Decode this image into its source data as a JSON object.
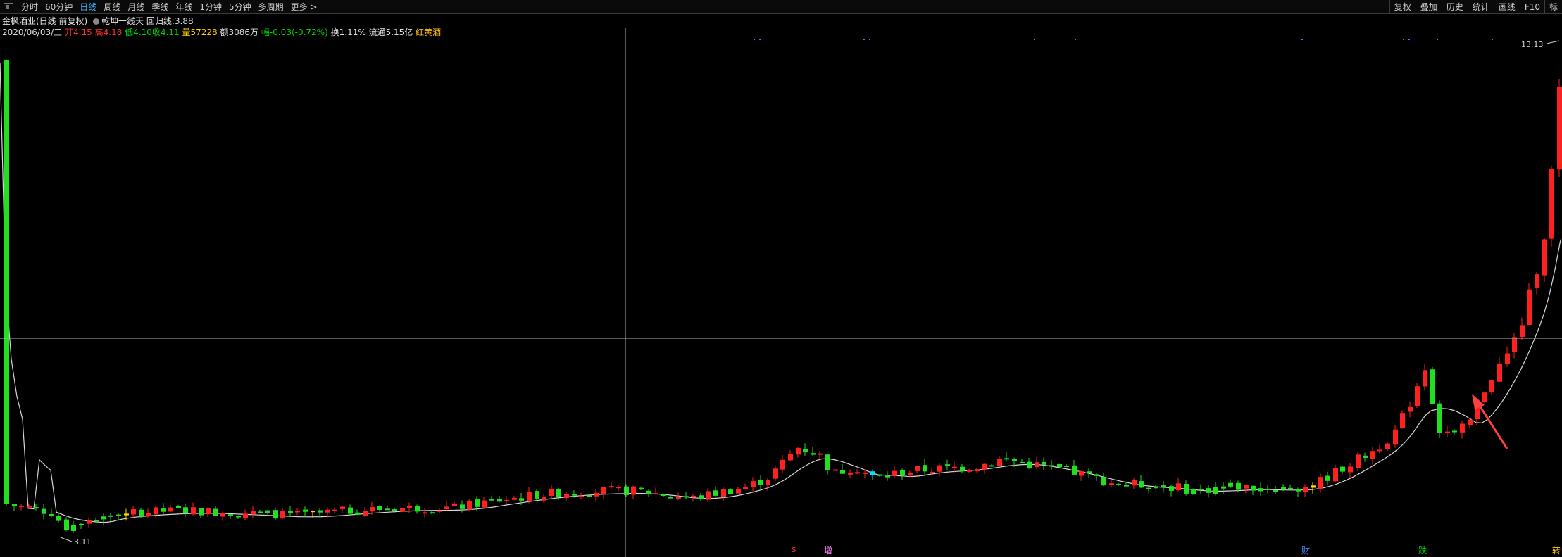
{
  "toolbar": {
    "items": [
      "分时",
      "60分钟",
      "日线",
      "周线",
      "月线",
      "季线",
      "年线",
      "1分钟",
      "5分钟",
      "多周期",
      "更多 >"
    ],
    "active": "日线",
    "right_buttons": [
      "复权",
      "叠加",
      "历史",
      "统计",
      "画线",
      "F10",
      "标"
    ]
  },
  "header": {
    "title": "金枫酒业(日线 前复权)",
    "indicator": "乾坤一线天",
    "return_line_label": "回归线:",
    "return_line_value": "3.88"
  },
  "quote": {
    "date": "2020/06/03/三",
    "open_label": "开",
    "open": "4.15",
    "high_label": "高",
    "high": "4.18",
    "low_label": "低",
    "low": "4.10",
    "close_label": "收",
    "close": "4.11",
    "volume_label": "量",
    "volume": "57228",
    "amount_label": "额",
    "amount": "3086万",
    "change_label": "幅",
    "change": "-0.03(-0.72%)",
    "turnover_label": "换",
    "turnover": "1.11%",
    "float_label": "流通",
    "float": "5.15亿",
    "sector": "红黄酒"
  },
  "chart_labels": {
    "max_price": "13.13",
    "min_price": "3.11"
  },
  "bottom_markers": [
    "s",
    "增",
    "财",
    "跌",
    "转"
  ],
  "colors": {
    "up": "#ff2020",
    "down": "#20e020",
    "signal": "#ffe000",
    "signal2": "#00e0ff",
    "ma": "#d8d8d8",
    "crosshair": "#b0b0b0",
    "arrow": "#ff4040"
  },
  "chart_data": {
    "type": "candlestick",
    "series": [
      {
        "name": "K线",
        "note": "daily candles, ~205 bars, rising from ~3.1 to 13.13"
      },
      {
        "name": "回归线"
      }
    ],
    "price_range": [
      3.11,
      13.13
    ]
  }
}
